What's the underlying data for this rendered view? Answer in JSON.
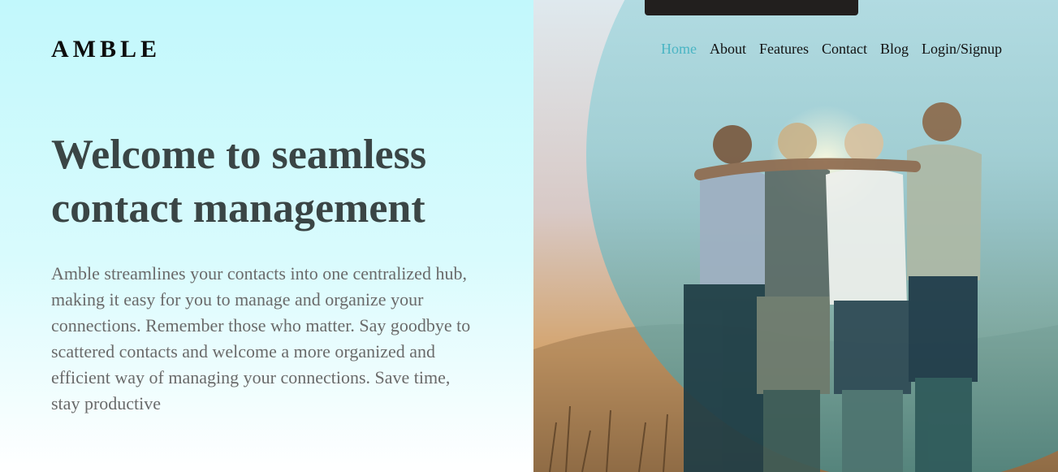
{
  "brand": {
    "name": "AMBLE"
  },
  "nav": {
    "items": [
      {
        "label": "Home",
        "active": true
      },
      {
        "label": "About",
        "active": false
      },
      {
        "label": "Features",
        "active": false
      },
      {
        "label": "Contact",
        "active": false
      },
      {
        "label": "Blog",
        "active": false
      },
      {
        "label": "Login/Signup",
        "active": false
      }
    ]
  },
  "hero": {
    "title": "Welcome to seamless contact management",
    "description": "Amble streamlines your contacts into one centralized hub, making it easy for you to manage and organize your connections. Remember those who matter. Say goodbye to scattered contacts and welcome a more organized and efficient way of managing your connections. Save time, stay productive"
  },
  "image": {
    "subject": "group of friends embracing outdoors at sunset"
  },
  "colors": {
    "accent": "#4ab5c4",
    "heading": "#3a4545",
    "body_text": "#6a6a6a",
    "left_bg_top": "#c2f8fc"
  }
}
